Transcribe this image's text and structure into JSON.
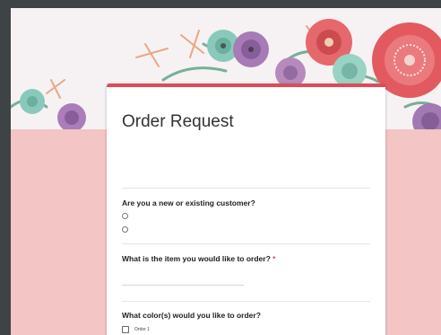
{
  "form": {
    "title": "Order Request",
    "description": "",
    "description_link": "",
    "required_note": "",
    "accent_color": "#db4d57",
    "background_color": "#f3c5c4"
  },
  "questions": [
    {
      "title": "Are you a new or existing customer?",
      "required": false,
      "type": "radio",
      "options": [
        "",
        ""
      ]
    },
    {
      "title": "What is the item you would like to order?",
      "required": true,
      "help": "",
      "type": "short_text",
      "placeholder": ""
    },
    {
      "title": "What color(s) would you like to order?",
      "required": false,
      "type": "checkbox",
      "options": [
        "Order 1"
      ]
    }
  ],
  "icons": {
    "radio": "radio-unchecked-icon",
    "checkbox": "checkbox-unchecked-icon"
  }
}
